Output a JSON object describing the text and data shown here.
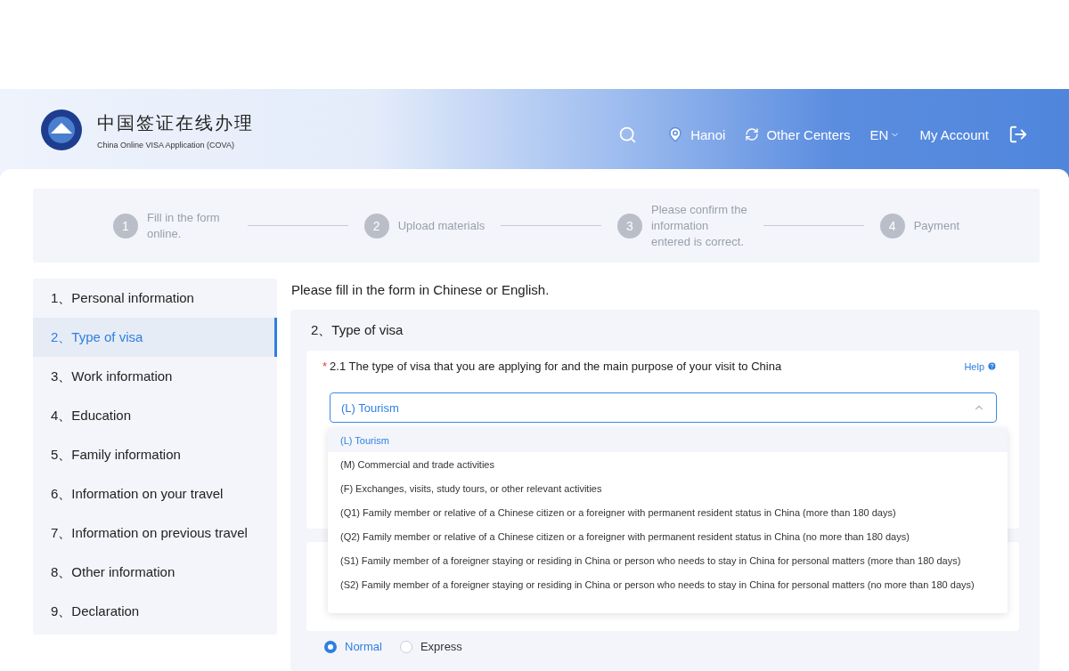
{
  "header": {
    "title": "中国签证在线办理",
    "subtitle": "China Online VISA Application (COVA)",
    "location": "Hanoi",
    "centers": "Other Centers",
    "language": "EN",
    "account": "My Account"
  },
  "steps": [
    {
      "number": "1",
      "label": "Fill in the form online."
    },
    {
      "number": "2",
      "label": "Upload materials"
    },
    {
      "number": "3",
      "label": "Please confirm the information entered is correct."
    },
    {
      "number": "4",
      "label": "Payment"
    }
  ],
  "sidebar": {
    "items": [
      {
        "label": "1、Personal information",
        "selected": false
      },
      {
        "label": "2、Type of visa",
        "selected": true
      },
      {
        "label": "3、Work information",
        "selected": false
      },
      {
        "label": "4、Education",
        "selected": false
      },
      {
        "label": "5、Family information",
        "selected": false
      },
      {
        "label": "6、Information on your travel",
        "selected": false
      },
      {
        "label": "7、Information on previous travel",
        "selected": false
      },
      {
        "label": "8、Other information",
        "selected": false
      },
      {
        "label": "9、Declaration",
        "selected": false
      }
    ]
  },
  "instruction": "Please fill in the form in Chinese or English.",
  "section": {
    "title": "2、Type of visa",
    "question": {
      "required_marker": "*",
      "label": "2.1 The type of visa that you are applying for and the main purpose of your visit to China",
      "help": "Help"
    },
    "select": {
      "value": "(L) Tourism",
      "expanded": true
    },
    "options": [
      {
        "label": "(L) Tourism",
        "selected": true
      },
      {
        "label": "(M) Commercial and trade activities",
        "selected": false
      },
      {
        "label": "(F) Exchanges, visits, study tours, or other relevant activities",
        "selected": false
      },
      {
        "label": "(Q1) Family member or relative of a Chinese citizen or a foreigner with permanent resident status in China (more than 180 days)",
        "selected": false
      },
      {
        "label": "(Q2) Family member or relative of a Chinese citizen or a foreigner with permanent resident status in China (no more than 180 days)",
        "selected": false
      },
      {
        "label": "(S1) Family member of a foreigner staying or residing in China or person who needs to stay in China for personal matters (more than 180 days)",
        "selected": false
      },
      {
        "label": "(S2) Family member of a foreigner staying or residing in China or person who needs to stay in China for personal matters (no more than 180 days)",
        "selected": false
      }
    ],
    "speed": [
      {
        "label": "Normal",
        "selected": true
      },
      {
        "label": "Express",
        "selected": false
      }
    ]
  }
}
